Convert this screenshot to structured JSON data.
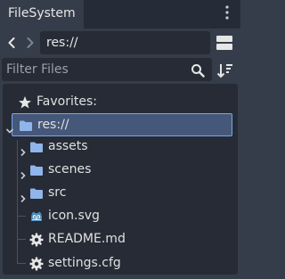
{
  "dock": {
    "tab_label": "FileSystem",
    "menu_icon": "dots-vertical-icon"
  },
  "path_bar": {
    "back_icon": "chevron-left-icon",
    "forward_icon": "chevron-right-icon",
    "path_value": "res://",
    "split_icon": "split-view-icon"
  },
  "filter": {
    "placeholder": "Filter Files",
    "search_icon": "search-icon",
    "sort_icon": "sort-icon"
  },
  "tree": {
    "favorites_label": "Favorites:",
    "favorites_icon": "star-icon",
    "root": {
      "label": "res://",
      "icon": "folder-icon",
      "expanded": true,
      "selected": true
    },
    "items": [
      {
        "label": "assets",
        "icon": "folder-icon",
        "type": "folder"
      },
      {
        "label": "scenes",
        "icon": "folder-icon",
        "type": "folder"
      },
      {
        "label": "src",
        "icon": "folder-icon",
        "type": "folder"
      },
      {
        "label": "icon.svg",
        "icon": "godot-icon",
        "type": "file"
      },
      {
        "label": "README.md",
        "icon": "gear-icon",
        "type": "file"
      },
      {
        "label": "settings.cfg",
        "icon": "gear-icon",
        "type": "file"
      }
    ]
  },
  "colors": {
    "folder": "#8fb5ea",
    "selection": "#45587a",
    "selection_border": "#7aa6e6",
    "godot": "#478cbf"
  }
}
